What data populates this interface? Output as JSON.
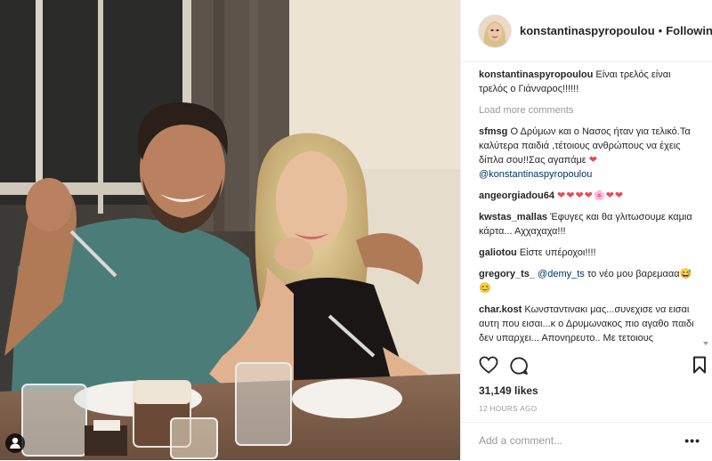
{
  "header": {
    "username": "konstantinaspyropoulou",
    "separator": "•",
    "follow_status": "Following"
  },
  "caption": {
    "username": "konstantinaspyropoulou",
    "text": "Είναι τρελός είναι τρελός ο Γιάνναρος!!!!!!"
  },
  "load_more": "Load more comments",
  "comments": [
    {
      "username": "sfmsg",
      "text": "Ο Δρύμων και ο Νασος ήταν για τελικό.Τα καλύτερα παιδιά ,τέτοιους ανθρώπους να έχεις δίπλα σου!!Σας αγαπάμε ",
      "hearts": "❤",
      "mention": "@konstantinaspyropoulou"
    },
    {
      "username": "angeorgiadou64",
      "hearts": "❤❤❤❤",
      "flower": "🌸",
      "hearts2": "❤❤"
    },
    {
      "username": "kwstas_mallas",
      "text": "Έφυγες και θα γλιτωσουμε καμια κάρτα... Αχχαχαχα!!!"
    },
    {
      "username": "galiotou",
      "text": "Είστε υπέροχοι!!!!"
    },
    {
      "username": "gregory_ts_",
      "mention": "@demy_ts",
      "text": " το νέο μου βαρεμααα",
      "emoji": "😅😊"
    },
    {
      "username": "char.kost",
      "text": "Κωνσταντινακι μας...συνεχισε να εισαι αυτη που εισαι...κ ο Δρυμωνακος πιο αγαθο παιδι δεν υπαρχει... Απονηρευτο.. Με τετοιους ανθρωπους να κανεις παρεα..."
    }
  ],
  "likes": "31,149 likes",
  "timestamp": "12 HOURS AGO",
  "add_comment_placeholder": "Add a comment...",
  "more_options": "•••",
  "colors": {
    "text": "#262626",
    "muted": "#999999",
    "heart": "#ed4956",
    "mention": "#003569",
    "border": "#efefef"
  },
  "icons": [
    "heart-outline-icon",
    "comment-bubble-icon",
    "bookmark-icon",
    "user-tag-icon",
    "more-options-icon"
  ]
}
